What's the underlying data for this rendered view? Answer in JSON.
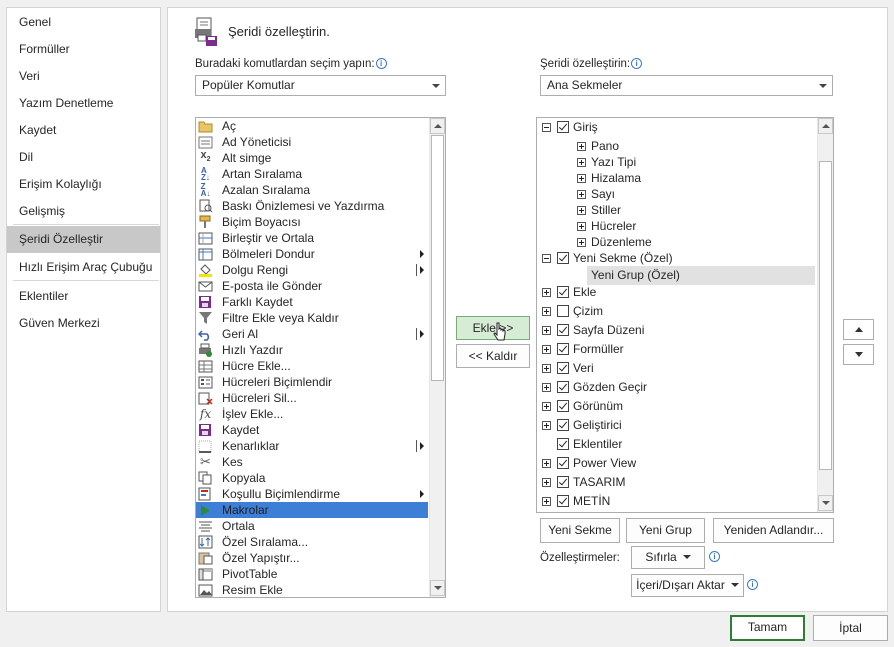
{
  "sidebar": {
    "items": [
      {
        "label": "Genel",
        "selected": false
      },
      {
        "label": "Formüller",
        "selected": false
      },
      {
        "label": "Veri",
        "selected": false
      },
      {
        "label": "Yazım Denetleme",
        "selected": false
      },
      {
        "label": "Kaydet",
        "selected": false
      },
      {
        "label": "Dil",
        "selected": false
      },
      {
        "label": "Erişim Kolaylığı",
        "selected": false
      },
      {
        "label": "Gelişmiş",
        "selected": false
      },
      {
        "label": "Şeridi Özelleştir",
        "selected": true
      },
      {
        "label": "Hızlı Erişim Araç Çubuğu",
        "selected": false
      },
      {
        "label": "Eklentiler",
        "selected": false
      },
      {
        "label": "Güven Merkezi",
        "selected": false
      }
    ]
  },
  "header": {
    "title": "Şeridi özelleştirin.",
    "icon": "ribbon-customize-icon"
  },
  "left_panel": {
    "label": "Buradaki komutlardan seçim yapın:",
    "dropdown_value": "Popüler Komutlar",
    "commands": [
      {
        "label": "Aç",
        "icon": "folder-open-icon",
        "submenu": false,
        "selected": false
      },
      {
        "label": "Ad Yöneticisi",
        "icon": "name-manager-icon",
        "submenu": false,
        "selected": false
      },
      {
        "label": "Alt simge",
        "icon": "subscript-icon",
        "submenu": false,
        "selected": false
      },
      {
        "label": "Artan Sıralama",
        "icon": "sort-ascending-icon",
        "submenu": false,
        "selected": false
      },
      {
        "label": "Azalan Sıralama",
        "icon": "sort-descending-icon",
        "submenu": false,
        "selected": false
      },
      {
        "label": "Baskı Önizlemesi ve Yazdırma",
        "icon": "print-preview-icon",
        "submenu": false,
        "selected": false
      },
      {
        "label": "Biçim Boyacısı",
        "icon": "format-painter-icon",
        "submenu": false,
        "selected": false
      },
      {
        "label": "Birleştir ve Ortala",
        "icon": "merge-center-icon",
        "submenu": false,
        "selected": false
      },
      {
        "label": "Bölmeleri Dondur",
        "icon": "freeze-panes-icon",
        "submenu": true,
        "selected": false
      },
      {
        "label": "Dolgu Rengi",
        "icon": "fill-color-icon",
        "submenu": "split",
        "selected": false
      },
      {
        "label": "E-posta ile Gönder",
        "icon": "email-icon",
        "submenu": false,
        "selected": false
      },
      {
        "label": "Farklı Kaydet",
        "icon": "save-as-icon",
        "submenu": false,
        "selected": false
      },
      {
        "label": "Filtre Ekle veya Kaldır",
        "icon": "filter-icon",
        "submenu": false,
        "selected": false
      },
      {
        "label": "Geri Al",
        "icon": "undo-icon",
        "submenu": "split",
        "selected": false
      },
      {
        "label": "Hızlı Yazdır",
        "icon": "quick-print-icon",
        "submenu": false,
        "selected": false
      },
      {
        "label": "Hücre Ekle...",
        "icon": "insert-cells-icon",
        "submenu": false,
        "selected": false
      },
      {
        "label": "Hücreleri Biçimlendir",
        "icon": "format-cells-icon",
        "submenu": false,
        "selected": false
      },
      {
        "label": "Hücreleri Sil...",
        "icon": "delete-cells-icon",
        "submenu": false,
        "selected": false
      },
      {
        "label": "İşlev Ekle...",
        "icon": "insert-function-icon",
        "submenu": false,
        "selected": false
      },
      {
        "label": "Kaydet",
        "icon": "save-icon",
        "submenu": false,
        "selected": false
      },
      {
        "label": "Kenarlıklar",
        "icon": "borders-icon",
        "submenu": "split",
        "selected": false
      },
      {
        "label": "Kes",
        "icon": "cut-icon",
        "submenu": false,
        "selected": false
      },
      {
        "label": "Kopyala",
        "icon": "copy-icon",
        "submenu": false,
        "selected": false
      },
      {
        "label": "Koşullu Biçimlendirme",
        "icon": "conditional-formatting-icon",
        "submenu": true,
        "selected": false
      },
      {
        "label": "Makrolar",
        "icon": "macros-icon",
        "submenu": false,
        "selected": true
      },
      {
        "label": "Ortala",
        "icon": "align-center-icon",
        "submenu": false,
        "selected": false
      },
      {
        "label": "Özel Sıralama...",
        "icon": "custom-sort-icon",
        "submenu": false,
        "selected": false
      },
      {
        "label": "Özel Yapıştır...",
        "icon": "paste-special-icon",
        "submenu": false,
        "selected": false
      },
      {
        "label": "PivotTable",
        "icon": "pivot-table-icon",
        "submenu": false,
        "selected": false
      },
      {
        "label": "Resim Ekle",
        "icon": "insert-picture-icon",
        "submenu": false,
        "selected": false
      }
    ]
  },
  "center": {
    "add_button": "Ekle >>",
    "remove_button": "<< Kaldır"
  },
  "right_panel": {
    "label": "Şeridi özelleştirin:",
    "dropdown_value": "Ana Sekmeler",
    "tree": [
      {
        "label": "Giriş",
        "level": 0,
        "expander": "minus",
        "checkbox": "checked"
      },
      {
        "label": "Pano",
        "level": 1,
        "expander": "plus",
        "checkbox": "none"
      },
      {
        "label": "Yazı Tipi",
        "level": 1,
        "expander": "plus",
        "checkbox": "none"
      },
      {
        "label": "Hizalama",
        "level": 1,
        "expander": "plus",
        "checkbox": "none"
      },
      {
        "label": "Sayı",
        "level": 1,
        "expander": "plus",
        "checkbox": "none"
      },
      {
        "label": "Stiller",
        "level": 1,
        "expander": "plus",
        "checkbox": "none"
      },
      {
        "label": "Hücreler",
        "level": 1,
        "expander": "plus",
        "checkbox": "none"
      },
      {
        "label": "Düzenleme",
        "level": 1,
        "expander": "plus",
        "checkbox": "none"
      },
      {
        "label": "Yeni Sekme (Özel)",
        "level": 0,
        "expander": "minus",
        "checkbox": "checked"
      },
      {
        "label": "Yeni Grup (Özel)",
        "level": 2,
        "expander": "none",
        "checkbox": "none",
        "selected": true
      },
      {
        "label": "Ekle",
        "level": 0,
        "expander": "plus",
        "checkbox": "checked"
      },
      {
        "label": "Çizim",
        "level": 0,
        "expander": "plus",
        "checkbox": "unchecked"
      },
      {
        "label": "Sayfa Düzeni",
        "level": 0,
        "expander": "plus",
        "checkbox": "checked"
      },
      {
        "label": "Formüller",
        "level": 0,
        "expander": "plus",
        "checkbox": "checked"
      },
      {
        "label": "Veri",
        "level": 0,
        "expander": "plus",
        "checkbox": "checked"
      },
      {
        "label": "Gözden Geçir",
        "level": 0,
        "expander": "plus",
        "checkbox": "checked"
      },
      {
        "label": "Görünüm",
        "level": 0,
        "expander": "plus",
        "checkbox": "checked"
      },
      {
        "label": "Geliştirici",
        "level": 0,
        "expander": "plus",
        "checkbox": "checked"
      },
      {
        "label": "Eklentiler",
        "level": 0,
        "expander": "none",
        "checkbox": "checked"
      },
      {
        "label": "Power View",
        "level": 0,
        "expander": "plus",
        "checkbox": "checked"
      },
      {
        "label": "TASARIM",
        "level": 0,
        "expander": "plus",
        "checkbox": "checked"
      },
      {
        "label": "METİN",
        "level": 0,
        "expander": "plus",
        "checkbox": "checked"
      }
    ],
    "new_tab_button": "Yeni Sekme",
    "new_group_button": "Yeni Grup",
    "rename_button": "Yeniden Adlandır...",
    "customizations_label": "Özelleştirmeler:",
    "reset_button": "Sıfırla",
    "import_export_button": "İçeri/Dışarı Aktar"
  },
  "footer": {
    "ok_button": "Tamam",
    "cancel_button": "İptal"
  },
  "colors": {
    "selection_blue": "#3d7fd6",
    "sidebar_selected": "#c8c8c8",
    "add_button_bg": "#d6ecd4",
    "ok_border": "#2e7d32",
    "info_blue": "#3a78c9"
  }
}
